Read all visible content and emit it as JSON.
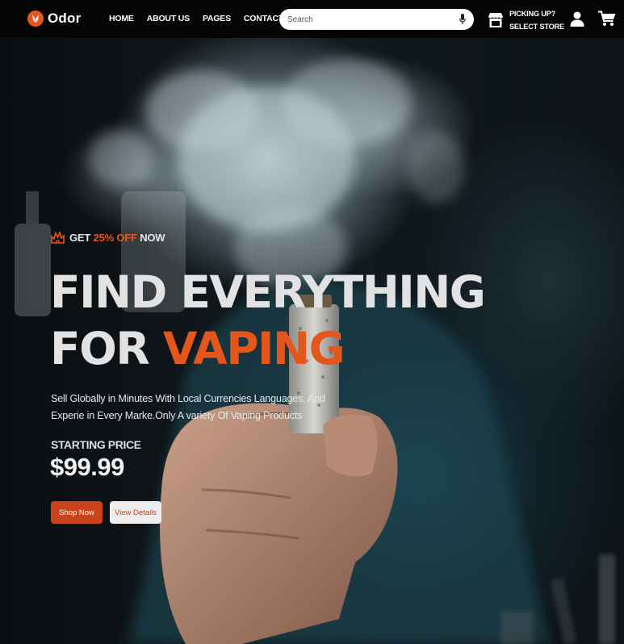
{
  "brand": {
    "name": "Odor",
    "accent_color": "#e4561c"
  },
  "nav": {
    "links": [
      {
        "label": "HOME"
      },
      {
        "label": "ABOUT US"
      },
      {
        "label": "PAGES"
      },
      {
        "label": "CONTACT"
      }
    ]
  },
  "search": {
    "placeholder": "Search",
    "value": "",
    "mic_icon": "microphone-icon"
  },
  "store": {
    "line1": "PICKING UP?",
    "line2": "SELECT STORE",
    "icon": "store-icon"
  },
  "header_icons": {
    "user": "user-icon",
    "cart": "cart-icon"
  },
  "hero": {
    "promo": {
      "prefix": "GET ",
      "highlight": "25% OFF",
      "suffix": " NOW",
      "icon": "fire-icon"
    },
    "headline": {
      "line1": "FIND EVERYTHING",
      "line2_prefix": "FOR ",
      "line2_highlight": "VAPING"
    },
    "description": "Sell Globally in Minutes With Local Currencies Languages, And Experie in Every Marke.Only A variety Of Vaping Products",
    "starting_price_label": "STARTING PRICE",
    "price": "$99.99",
    "primary_button": "Shop Now",
    "secondary_button": "View Details"
  }
}
